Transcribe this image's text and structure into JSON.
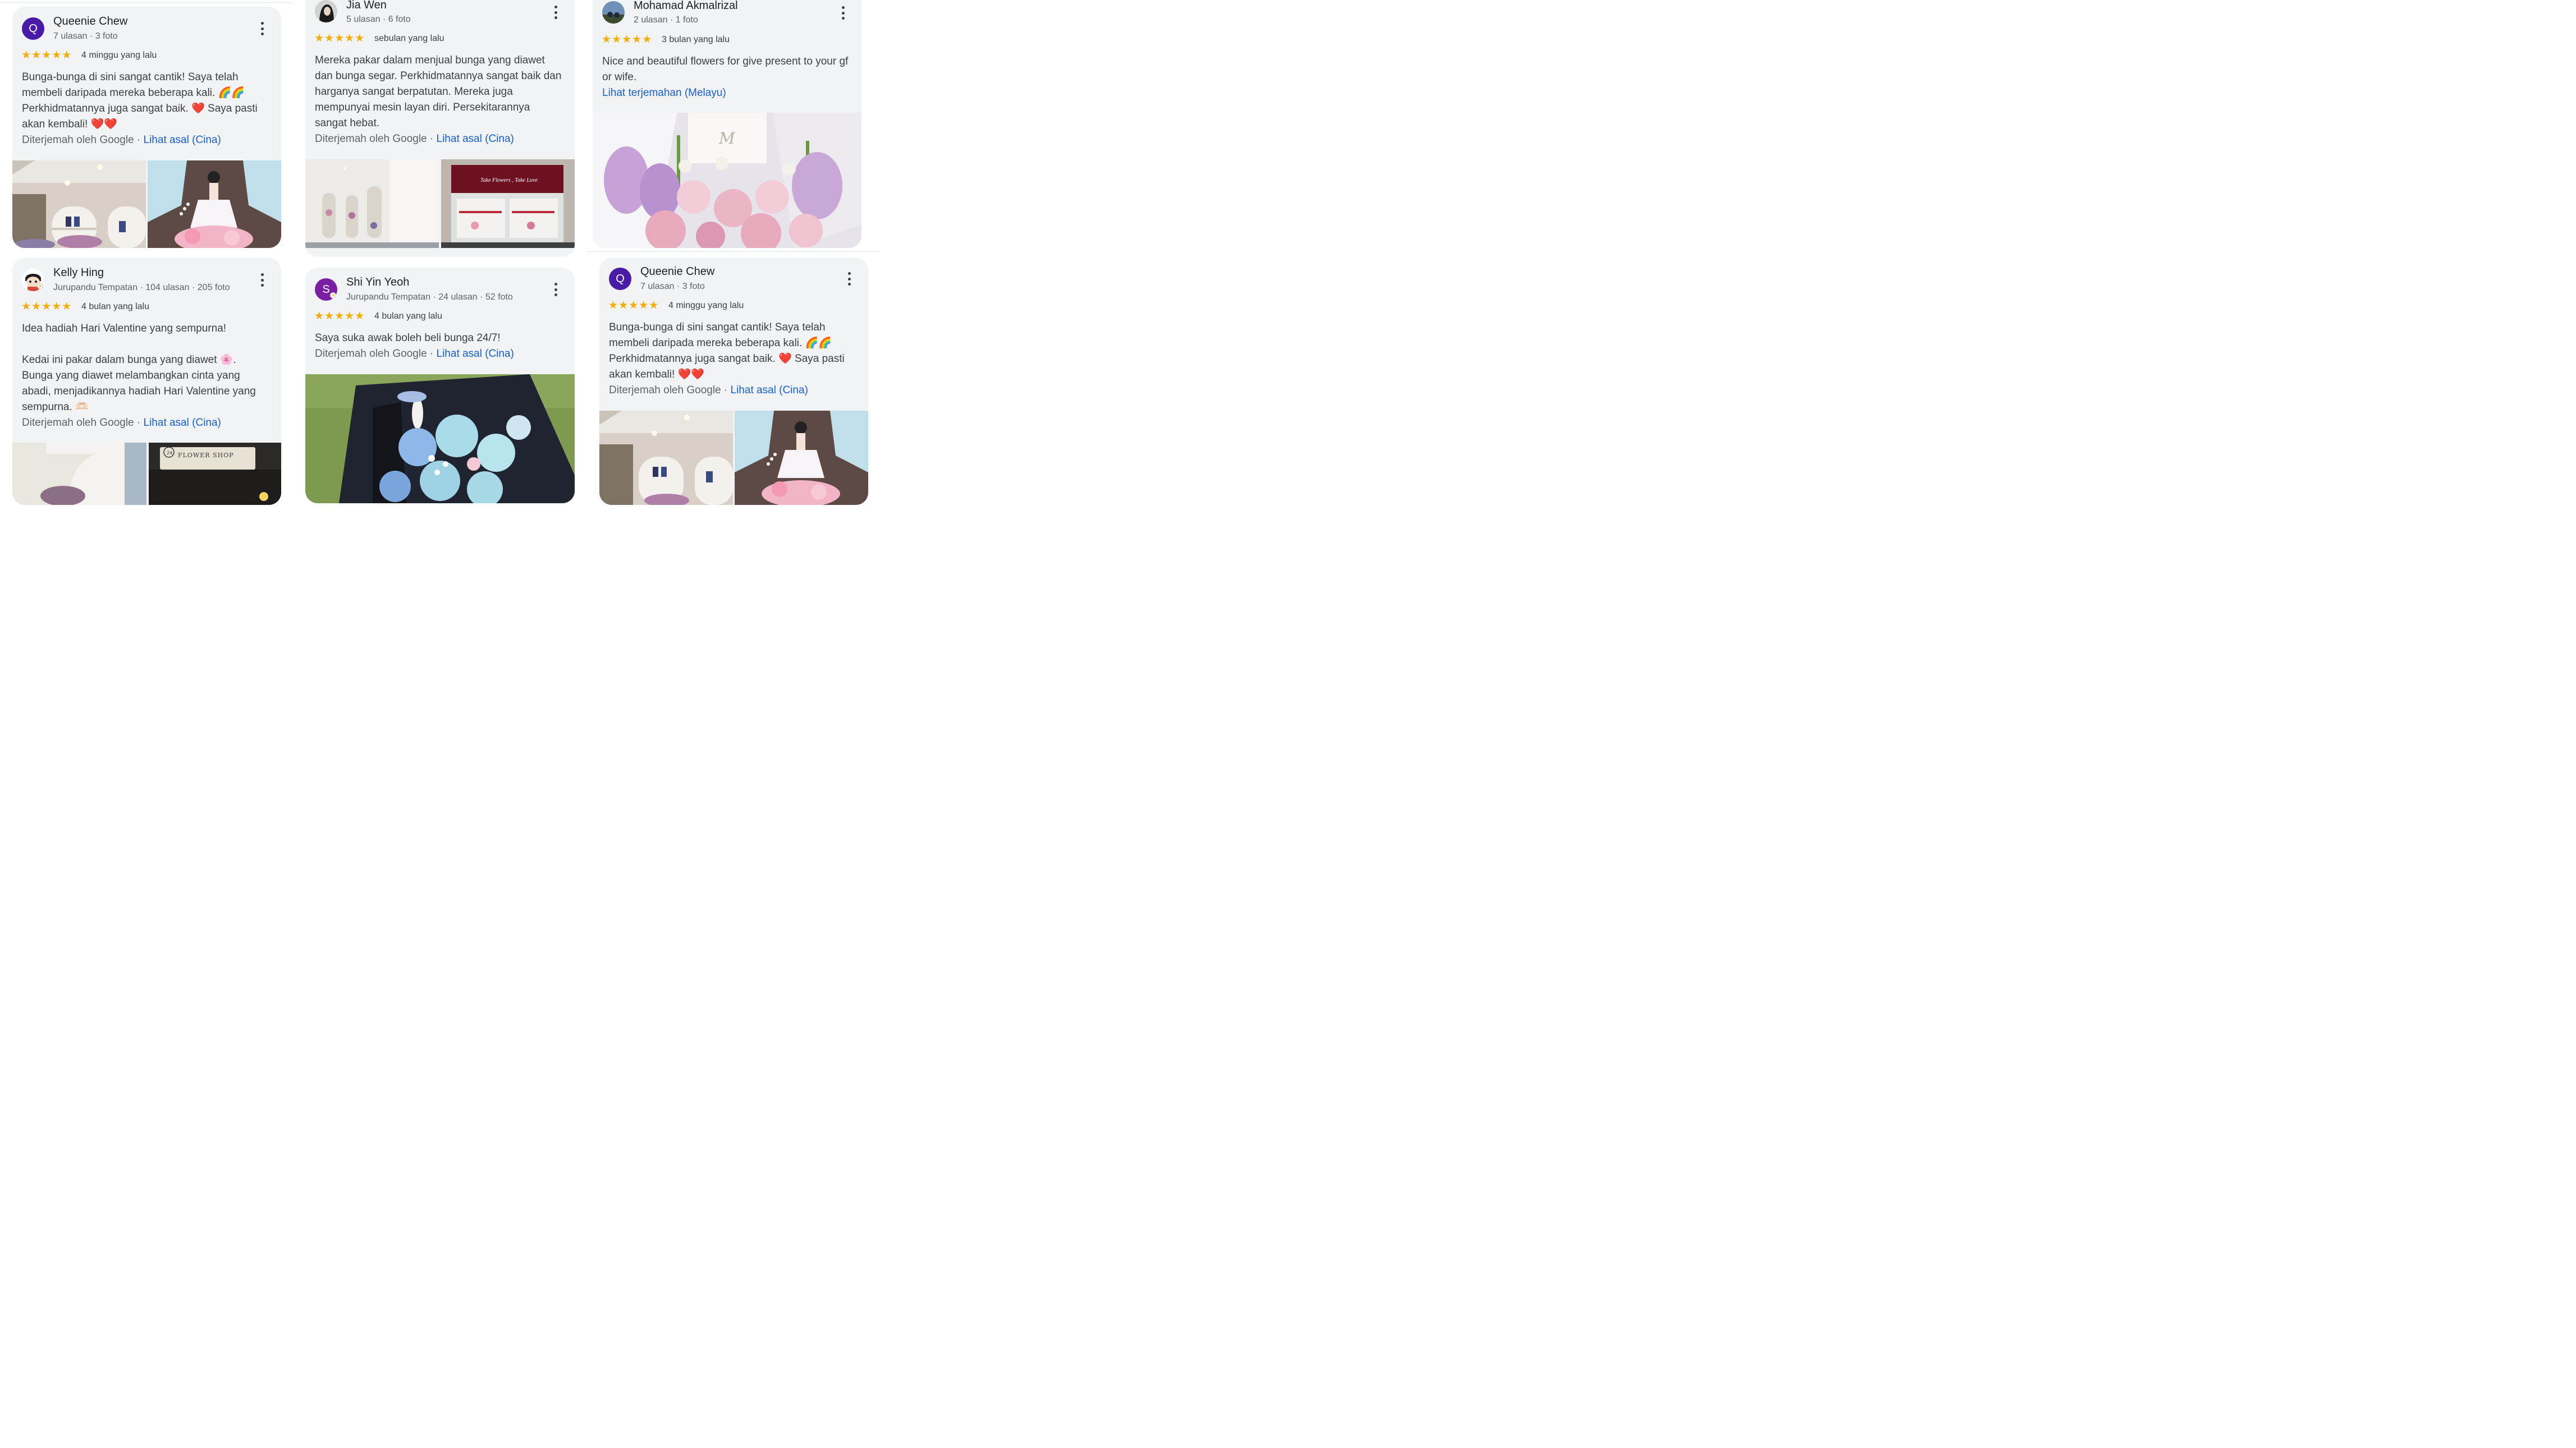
{
  "reviews": [
    {
      "name": "Queenie Chew",
      "initial": "Q",
      "meta": "7 ulasan · 3 foto",
      "stars": "★★★★★",
      "time": "4 minggu yang lalu",
      "text": [
        "Bunga-bunga di sini sangat cantik! Saya telah membeli daripada mereka beberapa kali. 🌈🌈 Perkhidmatannya juga sangat baik. ❤️ Saya pasti akan kembali! ❤️❤️"
      ],
      "translated_by": "Diterjemah oleh Google",
      "link": "Lihat asal (Cina)"
    },
    {
      "name": "Jia Wen",
      "meta": "5 ulasan · 6 foto",
      "stars": "★★★★★",
      "time": "sebulan yang lalu",
      "text": [
        "Mereka pakar dalam menjual bunga yang diawet dan bunga segar. Perkhidmatannya sangat baik dan harganya sangat berpatutan. Mereka juga mempunyai mesin layan diri. Persekitarannya sangat hebat."
      ],
      "translated_by": "Diterjemah oleh Google",
      "link": "Lihat asal (Cina)",
      "photo_text_1": "Take Flowers , Take Love"
    },
    {
      "name": "Mohamad Akmalrizal",
      "meta": "2 ulasan · 1 foto",
      "stars": "★★★★★",
      "time": "3 bulan yang lalu",
      "text": [
        "Nice and beautiful flowers for give present to your gf or wife."
      ],
      "link": "Lihat terjemahan (Melayu)"
    },
    {
      "name": "Kelly Hing",
      "meta": "Jurupandu Tempatan · 104 ulasan · 205 foto",
      "stars": "★★★★★",
      "time": "4 bulan yang lalu",
      "text": [
        "Idea hadiah Hari Valentine yang sempurna!",
        "Kedai ini pakar dalam bunga yang diawet 🌸. Bunga yang diawet melambangkan cinta yang abadi, menjadikannya hadiah Hari Valentine yang sempurna. 🫶🏻"
      ],
      "translated_by": "Diterjemah oleh Google",
      "link": "Lihat asal (Cina)",
      "photo_text_1": "FLOWER SHOP"
    },
    {
      "name": "Shi Yin Yeoh",
      "initial": "S",
      "meta": "Jurupandu Tempatan · 24 ulasan · 52 foto",
      "stars": "★★★★★",
      "time": "4 bulan yang lalu",
      "text": [
        "Saya suka awak boleh beli bunga 24/7!"
      ],
      "translated_by": "Diterjemah oleh Google",
      "link": "Lihat asal (Cina)"
    },
    {
      "name": "Queenie Chew",
      "initial": "Q",
      "meta": "7 ulasan · 3 foto",
      "stars": "★★★★★",
      "time": "4 minggu yang lalu",
      "text": [
        "Bunga-bunga di sini sangat cantik! Saya telah membeli daripada mereka beberapa kali. 🌈🌈 Perkhidmatannya juga sangat baik. ❤️ Saya pasti akan kembali! ❤️❤️"
      ],
      "translated_by": "Diterjemah oleh Google",
      "link": "Lihat asal (Cina)"
    }
  ],
  "colors": {
    "card_bg": "#f1f3f4",
    "star": "#f9ab00",
    "link": "#1a5fd0",
    "avatar_q": "#4a1aa8",
    "avatar_s": "#7b1fa2"
  }
}
